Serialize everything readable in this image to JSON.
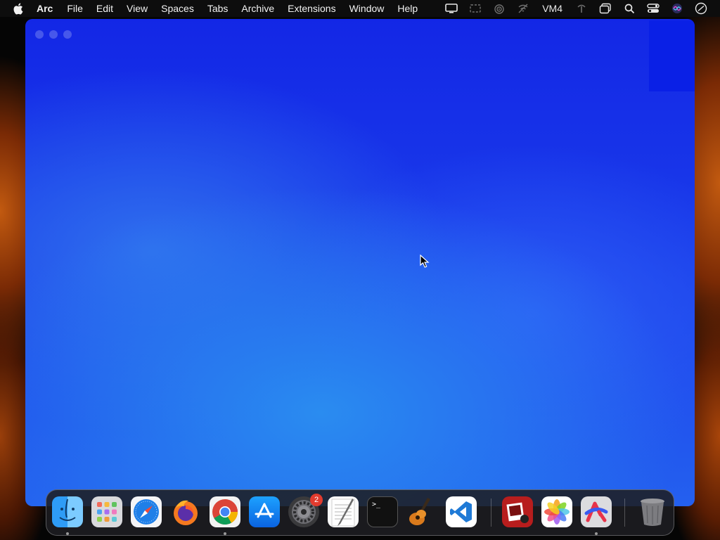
{
  "menubar": {
    "app_name": "Arc",
    "items": [
      "File",
      "Edit",
      "View",
      "Spaces",
      "Tabs",
      "Archive",
      "Extensions",
      "Window",
      "Help"
    ],
    "status_text": "VM4",
    "status_icons": [
      "display-icon",
      "screen-record-icon",
      "airdrop-icon",
      "no-wifi-icon",
      "vm-label",
      "antenna-icon",
      "window-switcher-icon",
      "search-icon",
      "control-center-icon",
      "siri-icon",
      "clock-icon"
    ]
  },
  "dock": {
    "apps": [
      {
        "name": "Finder",
        "icon": "finder-icon",
        "running": true
      },
      {
        "name": "Launchpad",
        "icon": "launchpad-icon",
        "running": false
      },
      {
        "name": "Safari",
        "icon": "safari-icon",
        "running": false
      },
      {
        "name": "Firefox",
        "icon": "firefox-icon",
        "running": false
      },
      {
        "name": "Google Chrome",
        "icon": "chrome-icon",
        "running": true
      },
      {
        "name": "App Store",
        "icon": "app-store-icon",
        "running": false
      },
      {
        "name": "System Settings",
        "icon": "settings-icon",
        "running": false,
        "badge": "2"
      },
      {
        "name": "TextEdit",
        "icon": "textedit-icon",
        "running": false
      },
      {
        "name": "Terminal",
        "icon": "terminal-icon",
        "running": false
      },
      {
        "name": "GarageBand",
        "icon": "garageband-icon",
        "running": false
      },
      {
        "name": "Visual Studio Code",
        "icon": "vscode-icon",
        "running": false
      },
      {
        "name": "Photo Booth",
        "icon": "photo-booth-icon",
        "running": false
      },
      {
        "name": "Photos",
        "icon": "photos-icon",
        "running": false
      },
      {
        "name": "Arc",
        "icon": "arc-icon",
        "running": true
      },
      {
        "name": "Trash",
        "icon": "trash-icon",
        "running": false
      }
    ],
    "terminal_prompt": ">_"
  },
  "colors": {
    "window_blue": "#1a3bea",
    "badge_red": "#e23b2e",
    "wallpaper_orange": "#c25a10"
  }
}
